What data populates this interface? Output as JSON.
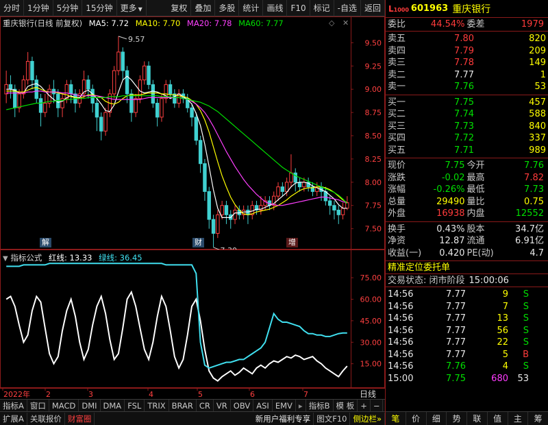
{
  "toolbar": {
    "left": [
      "分时",
      "1分钟",
      "5分钟",
      "15分钟",
      "更多"
    ],
    "right": [
      "复权",
      "叠加",
      "多股",
      "统计",
      "画线",
      "F10",
      "标记",
      "-自选",
      "返回"
    ]
  },
  "chart": {
    "title": "重庆银行(日线 前复权)",
    "ma": [
      {
        "label": "MA5: 7.72",
        "color": "#ffffff"
      },
      {
        "label": "MA10: 7.70",
        "color": "#ffff00"
      },
      {
        "label": "MA20: 7.78",
        "color": "#ff40ff"
      },
      {
        "label": "MA60: 7.77",
        "color": "#00e000"
      }
    ],
    "high_label": "9.57",
    "low_label": "7.30",
    "markers": [
      "解",
      "财",
      "增"
    ],
    "indicator_title": "指标公式",
    "indicator_red": "红线: 13.33",
    "indicator_green": "绿线: 36.45",
    "date_labels": [
      "2022年",
      "2",
      "3",
      "4",
      "5",
      "6",
      "7"
    ],
    "period_label": "日线"
  },
  "chart_data": [
    {
      "type": "line",
      "name_hint": "kline",
      "ylim": [
        7.35,
        9.65
      ],
      "yticks": [
        7.5,
        7.75,
        8.0,
        8.25,
        8.5,
        8.75,
        9.0,
        9.25,
        9.5
      ],
      "candles": [
        [
          8.95,
          9.05,
          9.2,
          8.85
        ],
        [
          9.05,
          9.0,
          9.15,
          8.9
        ],
        [
          9.0,
          8.8,
          9.05,
          8.7
        ],
        [
          8.8,
          8.95,
          9.0,
          8.75
        ],
        [
          8.95,
          9.1,
          9.15,
          8.9
        ],
        [
          9.1,
          9.3,
          9.4,
          9.05
        ],
        [
          9.3,
          9.1,
          9.35,
          9.0
        ],
        [
          9.1,
          8.9,
          9.15,
          8.85
        ],
        [
          8.9,
          8.75,
          8.95,
          8.6
        ],
        [
          8.75,
          8.85,
          8.95,
          8.7
        ],
        [
          8.85,
          9.0,
          9.05,
          8.8
        ],
        [
          9.0,
          8.95,
          9.1,
          8.85
        ],
        [
          8.95,
          8.8,
          9.0,
          8.7
        ],
        [
          8.8,
          8.9,
          8.95,
          8.7
        ],
        [
          8.9,
          9.05,
          9.1,
          8.85
        ],
        [
          9.05,
          8.95,
          9.1,
          8.85
        ],
        [
          8.95,
          8.85,
          9.0,
          8.75
        ],
        [
          8.85,
          8.95,
          9.0,
          8.8
        ],
        [
          8.95,
          9.1,
          9.2,
          8.9
        ],
        [
          9.1,
          9.0,
          9.15,
          8.9
        ],
        [
          9.0,
          8.85,
          9.05,
          8.75
        ],
        [
          8.85,
          8.7,
          8.9,
          8.55
        ],
        [
          8.7,
          8.55,
          8.75,
          8.45
        ],
        [
          8.55,
          8.75,
          8.8,
          8.5
        ],
        [
          8.75,
          8.95,
          9.0,
          8.7
        ],
        [
          8.95,
          9.2,
          9.25,
          8.9
        ],
        [
          9.2,
          9.4,
          9.57,
          9.15
        ],
        [
          9.4,
          9.2,
          9.45,
          9.1
        ],
        [
          9.2,
          8.95,
          9.25,
          8.85
        ],
        [
          8.95,
          8.75,
          9.0,
          8.65
        ],
        [
          8.75,
          8.9,
          8.95,
          8.7
        ],
        [
          8.9,
          9.1,
          9.15,
          8.85
        ],
        [
          9.1,
          9.25,
          9.3,
          9.05
        ],
        [
          9.25,
          9.05,
          9.3,
          9.0
        ],
        [
          9.05,
          8.85,
          9.1,
          8.8
        ],
        [
          8.85,
          8.7,
          8.9,
          8.6
        ],
        [
          8.7,
          8.9,
          8.95,
          8.65
        ],
        [
          8.9,
          9.05,
          9.1,
          8.85
        ],
        [
          9.05,
          8.95,
          9.1,
          8.9
        ],
        [
          8.95,
          8.85,
          9.0,
          8.8
        ],
        [
          8.85,
          8.95,
          9.0,
          8.8
        ],
        [
          8.95,
          8.9,
          9.0,
          8.85
        ],
        [
          8.9,
          8.8,
          8.95,
          8.75
        ],
        [
          8.8,
          8.7,
          8.85,
          8.6
        ],
        [
          8.7,
          8.45,
          8.75,
          8.4
        ],
        [
          8.45,
          8.2,
          8.5,
          8.1
        ],
        [
          8.2,
          7.9,
          8.25,
          7.8
        ],
        [
          7.9,
          7.6,
          7.95,
          7.5
        ],
        [
          7.6,
          7.45,
          7.65,
          7.3
        ],
        [
          7.45,
          7.65,
          7.7,
          7.4
        ],
        [
          7.65,
          7.75,
          7.8,
          7.6
        ],
        [
          7.75,
          7.65,
          7.8,
          7.55
        ],
        [
          7.65,
          7.6,
          7.7,
          7.5
        ],
        [
          7.6,
          7.7,
          7.75,
          7.55
        ],
        [
          7.7,
          7.65,
          7.75,
          7.6
        ],
        [
          7.65,
          7.7,
          7.75,
          7.6
        ],
        [
          7.7,
          7.65,
          7.75,
          7.55
        ],
        [
          7.65,
          7.75,
          7.8,
          7.6
        ],
        [
          7.75,
          7.7,
          7.8,
          7.65
        ],
        [
          7.7,
          7.75,
          7.85,
          7.65
        ],
        [
          7.75,
          7.8,
          7.85,
          7.7
        ],
        [
          7.8,
          7.75,
          7.85,
          7.7
        ],
        [
          7.75,
          7.85,
          7.9,
          7.7
        ],
        [
          7.85,
          7.95,
          8.0,
          7.8
        ],
        [
          7.95,
          7.9,
          8.0,
          7.85
        ],
        [
          7.9,
          8.0,
          8.05,
          7.85
        ],
        [
          8.0,
          8.1,
          8.3,
          7.95
        ],
        [
          8.1,
          8.0,
          8.15,
          7.9
        ],
        [
          8.0,
          7.95,
          8.05,
          7.9
        ],
        [
          7.95,
          8.0,
          8.05,
          7.9
        ],
        [
          8.0,
          7.95,
          8.05,
          7.9
        ],
        [
          7.95,
          7.9,
          8.0,
          7.85
        ],
        [
          7.9,
          7.95,
          8.0,
          7.85
        ],
        [
          7.95,
          7.9,
          8.0,
          7.8
        ],
        [
          7.9,
          7.8,
          7.95,
          7.75
        ],
        [
          7.8,
          7.75,
          7.85,
          7.65
        ],
        [
          7.75,
          7.7,
          7.8,
          7.6
        ],
        [
          7.7,
          7.65,
          7.75,
          7.55
        ],
        [
          7.65,
          7.72,
          7.78,
          7.6
        ],
        [
          7.72,
          7.78,
          7.85,
          7.7
        ]
      ],
      "series": [
        {
          "name": "MA5",
          "color": "#ffffff",
          "values": [
            9.0,
            9.0,
            8.99,
            8.96,
            8.96,
            9.03,
            9.05,
            9.06,
            9.03,
            8.98,
            8.93,
            8.89,
            8.86,
            8.87,
            8.91,
            8.93,
            8.91,
            8.91,
            8.97,
            8.99,
            8.95,
            8.9,
            8.84,
            8.77,
            8.76,
            8.83,
            8.97,
            9.1,
            9.14,
            9.1,
            9.04,
            8.98,
            8.96,
            8.97,
            8.98,
            8.97,
            8.95,
            8.93,
            8.9,
            8.92,
            8.95,
            8.92,
            8.89,
            8.84,
            8.74,
            8.61,
            8.41,
            8.17,
            7.92,
            7.72,
            7.62,
            7.62,
            7.62,
            7.67,
            7.67,
            7.68,
            7.68,
            7.69,
            7.71,
            7.71,
            7.73,
            7.75,
            7.77,
            7.81,
            7.85,
            7.89,
            7.95,
            7.99,
            8.0,
            8.0,
            7.99,
            7.96,
            7.94,
            7.92,
            7.9,
            7.86,
            7.82,
            7.76,
            7.72,
            7.72
          ]
        },
        {
          "name": "MA10",
          "color": "#ffff00",
          "values": [
            8.98,
            8.98,
            8.98,
            8.97,
            8.97,
            8.99,
            9.01,
            9.02,
            9.0,
            8.98,
            8.97,
            8.97,
            8.96,
            8.95,
            8.94,
            8.92,
            8.91,
            8.9,
            8.92,
            8.94,
            8.94,
            8.93,
            8.91,
            8.87,
            8.85,
            8.84,
            8.86,
            8.9,
            8.93,
            8.94,
            8.94,
            8.94,
            8.95,
            8.96,
            8.96,
            8.96,
            8.95,
            8.95,
            8.94,
            8.94,
            8.93,
            8.92,
            8.91,
            8.88,
            8.84,
            8.77,
            8.67,
            8.54,
            8.38,
            8.22,
            8.07,
            7.95,
            7.84,
            7.76,
            7.7,
            7.66,
            7.65,
            7.66,
            7.68,
            7.69,
            7.7,
            7.71,
            7.73,
            7.75,
            7.78,
            7.81,
            7.85,
            7.88,
            7.91,
            7.93,
            7.94,
            7.94,
            7.95,
            7.95,
            7.94,
            7.92,
            7.89,
            7.85,
            7.81,
            7.78
          ]
        },
        {
          "name": "MA20",
          "color": "#ff40ff",
          "values": [
            8.96,
            8.96,
            8.96,
            8.96,
            8.96,
            8.97,
            8.97,
            8.98,
            8.98,
            8.97,
            8.97,
            8.97,
            8.97,
            8.96,
            8.96,
            8.95,
            8.94,
            8.93,
            8.93,
            8.93,
            8.93,
            8.93,
            8.92,
            8.91,
            8.9,
            8.89,
            8.89,
            8.89,
            8.89,
            8.89,
            8.89,
            8.89,
            8.9,
            8.91,
            8.91,
            8.91,
            8.91,
            8.91,
            8.91,
            8.91,
            8.91,
            8.9,
            8.89,
            8.87,
            8.84,
            8.8,
            8.75,
            8.68,
            8.6,
            8.51,
            8.42,
            8.33,
            8.25,
            8.17,
            8.1,
            8.03,
            7.97,
            7.92,
            7.87,
            7.83,
            7.79,
            7.77,
            7.76,
            7.75,
            7.75,
            7.76,
            7.77,
            7.78,
            7.79,
            7.8,
            7.81,
            7.82,
            7.83,
            7.84,
            7.84,
            7.83,
            7.82,
            7.81,
            7.79,
            7.78
          ]
        },
        {
          "name": "MA60",
          "color": "#00e000",
          "values": [
            8.78,
            8.79,
            8.8,
            8.81,
            8.82,
            8.83,
            8.84,
            8.85,
            8.85,
            8.86,
            8.87,
            8.87,
            8.88,
            8.88,
            8.89,
            8.89,
            8.9,
            8.9,
            8.9,
            8.91,
            8.91,
            8.91,
            8.91,
            8.91,
            8.92,
            8.92,
            8.92,
            8.93,
            8.93,
            8.93,
            8.93,
            8.93,
            8.93,
            8.93,
            8.93,
            8.93,
            8.92,
            8.92,
            8.92,
            8.91,
            8.91,
            8.9,
            8.89,
            8.88,
            8.87,
            8.86,
            8.84,
            8.82,
            8.79,
            8.76,
            8.72,
            8.68,
            8.64,
            8.6,
            8.56,
            8.52,
            8.48,
            8.44,
            8.4,
            8.36,
            8.32,
            8.28,
            8.24,
            8.2,
            8.16,
            8.13,
            8.1,
            8.07,
            8.05,
            8.03,
            8.01,
            7.99,
            7.97,
            7.95,
            7.93,
            7.91,
            7.89,
            7.86,
            7.82,
            7.77
          ]
        }
      ]
    },
    {
      "type": "line",
      "name_hint": "indicator",
      "ylim": [
        0,
        88
      ],
      "yticks": [
        15.0,
        30.0,
        45.0,
        60.0,
        75.0
      ],
      "series": [
        {
          "name": "红线",
          "color": "#ffffff",
          "values": [
            60,
            62,
            55,
            42,
            30,
            35,
            52,
            62,
            58,
            40,
            22,
            15,
            20,
            38,
            52,
            60,
            48,
            30,
            18,
            25,
            42,
            55,
            62,
            50,
            32,
            18,
            22,
            40,
            60,
            65,
            55,
            40,
            25,
            18,
            30,
            48,
            62,
            55,
            38,
            20,
            12,
            18,
            35,
            55,
            60,
            45,
            25,
            10,
            5,
            3,
            6,
            8,
            10,
            7,
            9,
            12,
            10,
            8,
            12,
            14,
            12,
            15,
            17,
            16,
            18,
            20,
            19,
            21,
            20,
            18,
            19,
            20,
            17,
            15,
            12,
            10,
            8,
            6,
            10,
            13.33
          ]
        },
        {
          "name": "绿线",
          "color": "#40e0f0",
          "values": [
            83,
            83,
            83,
            83,
            84,
            84,
            84,
            84,
            84,
            84,
            85,
            85,
            85,
            85,
            85,
            85,
            85,
            85,
            85,
            85,
            85,
            85,
            85,
            85,
            85,
            85,
            85,
            85,
            85,
            85,
            85,
            85,
            85,
            85,
            85,
            85,
            85,
            84,
            84,
            84,
            84,
            84,
            84,
            84,
            78,
            30,
            14,
            12,
            13,
            14,
            15,
            16,
            16,
            17,
            18,
            18,
            20,
            22,
            24,
            26,
            30,
            40,
            50,
            46,
            44,
            44,
            43,
            42,
            41,
            38,
            36,
            36,
            35,
            35,
            34,
            34,
            35,
            36,
            36.45,
            36.45
          ]
        }
      ]
    }
  ],
  "tabs1": [
    "指标A",
    "窗口",
    "MACD",
    "DMI",
    "DMA",
    "FSL",
    "TRIX",
    "BRAR",
    "CR",
    "VR",
    "OBV",
    "ASI",
    "EMV",
    "指标B",
    "模 板",
    "+",
    "−"
  ],
  "tabs2": [
    "扩展A",
    "关联报价",
    "财富圈",
    "新用户福利专享",
    "图文F10",
    "侧边栏"
  ],
  "stock": {
    "level": "L",
    "level_sub": "1000",
    "code": "601963",
    "name": "重庆银行"
  },
  "weibi": {
    "k1": "委比",
    "v1": "44.54%",
    "k2": "委差",
    "v2": "1979"
  },
  "asks": [
    {
      "k": "卖五",
      "p": "7.80",
      "v": "820"
    },
    {
      "k": "卖四",
      "p": "7.79",
      "v": "209"
    },
    {
      "k": "卖三",
      "p": "7.78",
      "v": "149"
    },
    {
      "k": "卖二",
      "p": "7.77",
      "v": "1"
    },
    {
      "k": "卖一",
      "p": "7.76",
      "v": "53"
    }
  ],
  "bids": [
    {
      "k": "买一",
      "p": "7.75",
      "v": "457"
    },
    {
      "k": "买二",
      "p": "7.74",
      "v": "588"
    },
    {
      "k": "买三",
      "p": "7.73",
      "v": "840"
    },
    {
      "k": "买四",
      "p": "7.72",
      "v": "337"
    },
    {
      "k": "买五",
      "p": "7.71",
      "v": "989"
    }
  ],
  "quote": [
    {
      "k1": "现价",
      "v1": "7.75",
      "k2": "今开",
      "v2": "7.76"
    },
    {
      "k1": "涨跌",
      "v1": "-0.02",
      "k2": "最高",
      "v2": "7.82"
    },
    {
      "k1": "涨幅",
      "v1": "-0.26%",
      "k2": "最低",
      "v2": "7.73"
    },
    {
      "k1": "总量",
      "v1": "29490",
      "k2": "量比",
      "v2": "0.75"
    },
    {
      "k1": "外盘",
      "v1": "16938",
      "k2": "内盘",
      "v2": "12552"
    }
  ],
  "fin": [
    {
      "k1": "换手",
      "v1": "0.43%",
      "k2": "股本",
      "v2": "34.7亿"
    },
    {
      "k1": "净资",
      "v1": "12.87",
      "k2": "流通",
      "v2": "6.91亿"
    },
    {
      "k1": "收益(一)",
      "v1": "0.420",
      "k2": "PE(动)",
      "v2": "4.7"
    }
  ],
  "precise_title": "精准定位委托单",
  "trade_status": {
    "label": "交易状态: 闭市阶段",
    "time": "15:00:06"
  },
  "ticks": [
    {
      "t": "14:56",
      "p": "7.77",
      "v": "9",
      "d": "S"
    },
    {
      "t": "14:56",
      "p": "7.77",
      "v": "7",
      "d": "S"
    },
    {
      "t": "14:56",
      "p": "7.77",
      "v": "13",
      "d": "S"
    },
    {
      "t": "14:56",
      "p": "7.77",
      "v": "56",
      "d": "S"
    },
    {
      "t": "14:56",
      "p": "7.77",
      "v": "22",
      "d": "S"
    },
    {
      "t": "14:56",
      "p": "7.77",
      "v": "5",
      "d": "B"
    },
    {
      "t": "14:56",
      "p": "7.76",
      "v": "4",
      "d": "S"
    },
    {
      "t": "15:00",
      "p": "7.75",
      "v": "680",
      "d": "53"
    }
  ],
  "right_tabs": [
    "笔",
    "价",
    "细",
    "势",
    "联",
    "值",
    "主",
    "筹"
  ]
}
